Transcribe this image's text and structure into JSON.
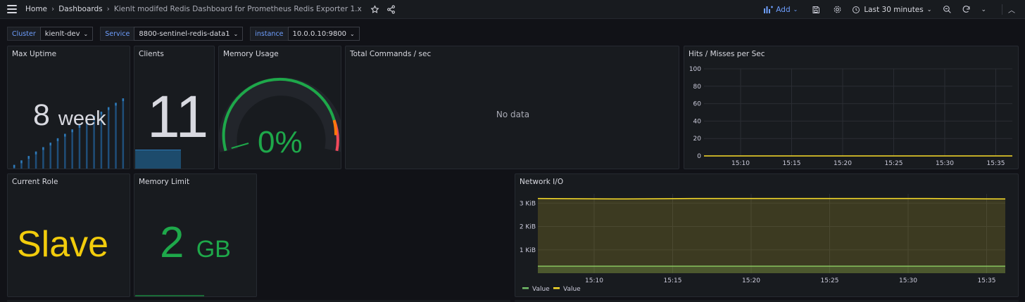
{
  "breadcrumb": {
    "home": "Home",
    "dashboards": "Dashboards",
    "current": "Kienlt modifed Redis Dashboard for Prometheus Redis Exporter 1.x"
  },
  "toolbar": {
    "add_label": "Add",
    "time_range": "Last 30 minutes"
  },
  "variables": [
    {
      "label": "Cluster",
      "value": "kienlt-dev"
    },
    {
      "label": "Service",
      "value": "8800-sentinel-redis-data1"
    },
    {
      "label": "instance",
      "value": "10.0.0.10:9800"
    }
  ],
  "panels": {
    "uptime": {
      "title": "Max Uptime",
      "value": "8",
      "unit": "week",
      "sparkline": [
        1,
        2,
        3,
        4,
        5,
        6,
        7,
        8,
        9,
        10,
        11,
        12,
        13,
        14,
        15,
        16
      ]
    },
    "clients": {
      "title": "Clients",
      "value": "11"
    },
    "memory_usage": {
      "title": "Memory Usage",
      "value": "0%",
      "percent": 0
    },
    "total_commands": {
      "title": "Total Commands / sec",
      "empty_text": "No data"
    },
    "hits": {
      "title": "Hits / Misses per Sec"
    },
    "current_role": {
      "title": "Current Role",
      "value": "Slave"
    },
    "memory_limit": {
      "title": "Memory Limit",
      "value": "2",
      "unit": "GB"
    },
    "network": {
      "title": "Network I/O"
    }
  },
  "colors": {
    "accent": "#6e9fff",
    "green": "#1ea84a",
    "yellow": "#f2cc0c",
    "series_green": "#73bf69",
    "series_yellow": "#fade2a",
    "spark": "#1f60c4"
  },
  "chart_data": [
    {
      "type": "line",
      "title": "Hits / Misses per Sec",
      "x": [
        "15:10",
        "15:15",
        "15:20",
        "15:25",
        "15:30",
        "15:35"
      ],
      "yticks": [
        "100",
        "80",
        "60",
        "40",
        "20",
        "0"
      ],
      "ylim": [
        0,
        100
      ],
      "series": [
        {
          "values": [
            0,
            0,
            0,
            0,
            0,
            0
          ]
        }
      ],
      "grid": true
    },
    {
      "type": "area",
      "title": "Network I/O",
      "x": [
        "15:10",
        "15:15",
        "15:20",
        "15:25",
        "15:30",
        "15:35"
      ],
      "yticks": [
        "3 KiB",
        "2 KiB",
        "1 KiB"
      ],
      "ylim": [
        0,
        3.4
      ],
      "series": [
        {
          "name": "Value",
          "color": "green",
          "values": [
            0.3,
            0.3,
            0.3,
            0.3,
            0.3,
            0.3,
            0.3
          ]
        },
        {
          "name": "Value",
          "color": "yellow",
          "values": [
            3.2,
            3.18,
            3.2,
            3.2,
            3.2,
            3.2,
            3.18
          ]
        }
      ],
      "legend": "bottom-left",
      "grid": true
    }
  ]
}
